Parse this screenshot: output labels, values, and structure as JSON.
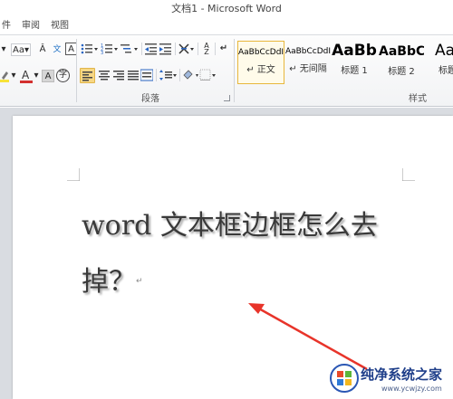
{
  "window": {
    "title": "文档1 - Microsoft Word"
  },
  "menu": {
    "tabs": [
      "件",
      "审阅",
      "视图"
    ]
  },
  "ribbon": {
    "paragraph_group_label": "段落",
    "styles_group_label": "样式",
    "styles": [
      {
        "sample": "AaBbCcDdI",
        "name": "↵ 正文"
      },
      {
        "sample": "AaBbCcDdI",
        "name": "↵ 无间隔"
      },
      {
        "sample": "AaBb",
        "name": "标题 1"
      },
      {
        "sample": "AaBbC",
        "name": "标题 2"
      },
      {
        "sample": "Aa",
        "name": "标题"
      }
    ],
    "colors": {
      "highlight": "#f7e23a",
      "font_color": "#d3302f",
      "accent_active": "#e8b73c"
    }
  },
  "document": {
    "line1": "word 文本框边框怎么去",
    "line2": "掉？"
  },
  "annotation": {
    "arrow_color": "#e8342a"
  },
  "watermark": {
    "title": "纯净系统之家",
    "url": "www.ycwjzy.com"
  }
}
